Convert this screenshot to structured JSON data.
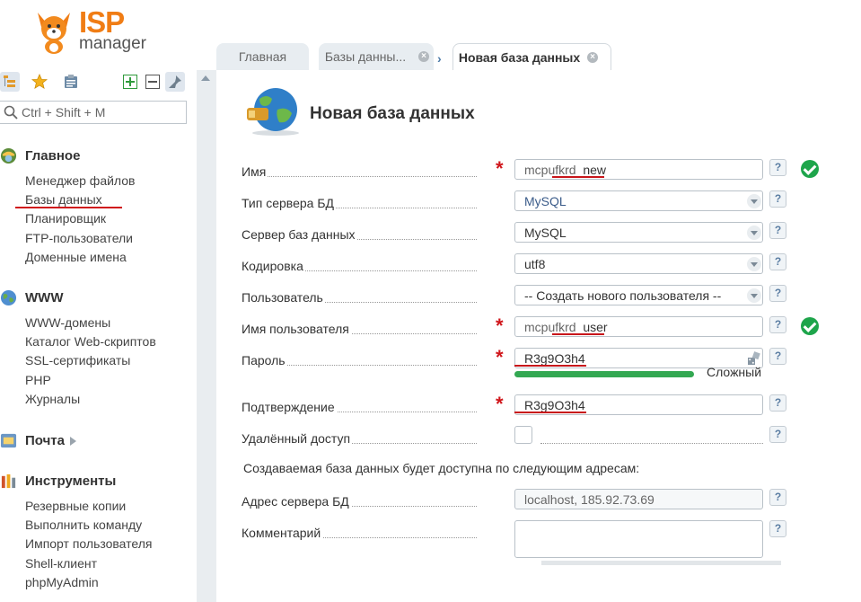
{
  "logo": {
    "word1": "ISP",
    "word2": "manager"
  },
  "sidebar": {
    "search_placeholder": "Ctrl + Shift + M",
    "sections": [
      {
        "title": "Главное",
        "items": [
          "Менеджер файлов",
          "Базы данных",
          "Планировщик",
          "FTP-пользователи",
          "Доменные имена"
        ]
      },
      {
        "title": "WWW",
        "items": [
          "WWW-домены",
          "Каталог Web-скриптов",
          "SSL-сертификаты",
          "PHP",
          "Журналы"
        ]
      },
      {
        "title": "Почта",
        "items": []
      },
      {
        "title": "Инструменты",
        "items": [
          "Резервные копии",
          "Выполнить команду",
          "Импорт пользователя",
          "Shell-клиент",
          "phpMyAdmin"
        ]
      }
    ]
  },
  "tabs": [
    {
      "label": "Главная"
    },
    {
      "label": "Базы данны..."
    },
    {
      "label": "Новая база данных"
    }
  ],
  "form": {
    "title": "Новая база данных",
    "name": {
      "label": "Имя",
      "prefix": "mcpufkrd_",
      "value": "new"
    },
    "server_type": {
      "label": "Тип сервера БД",
      "value": "MySQL"
    },
    "db_server": {
      "label": "Сервер баз данных",
      "value": "MySQL"
    },
    "encoding": {
      "label": "Кодировка",
      "value": "utf8"
    },
    "user": {
      "label": "Пользователь",
      "value": "-- Создать нового пользователя --"
    },
    "username": {
      "label": "Имя пользователя",
      "prefix": "mcpufkrd_",
      "value": "user"
    },
    "password": {
      "label": "Пароль",
      "value": "R3g9O3h4",
      "strength_label": "Сложный"
    },
    "confirm": {
      "label": "Подтверждение",
      "value": "R3g9O3h4"
    },
    "remote": {
      "label": "Удалённый доступ"
    },
    "note": "Создаваемая база данных будет доступна по следующим адресам:",
    "address": {
      "label": "Адрес сервера БД",
      "value": "localhost, 185.92.73.69"
    },
    "comment": {
      "label": "Комментарий"
    },
    "help_symbol": "?"
  }
}
